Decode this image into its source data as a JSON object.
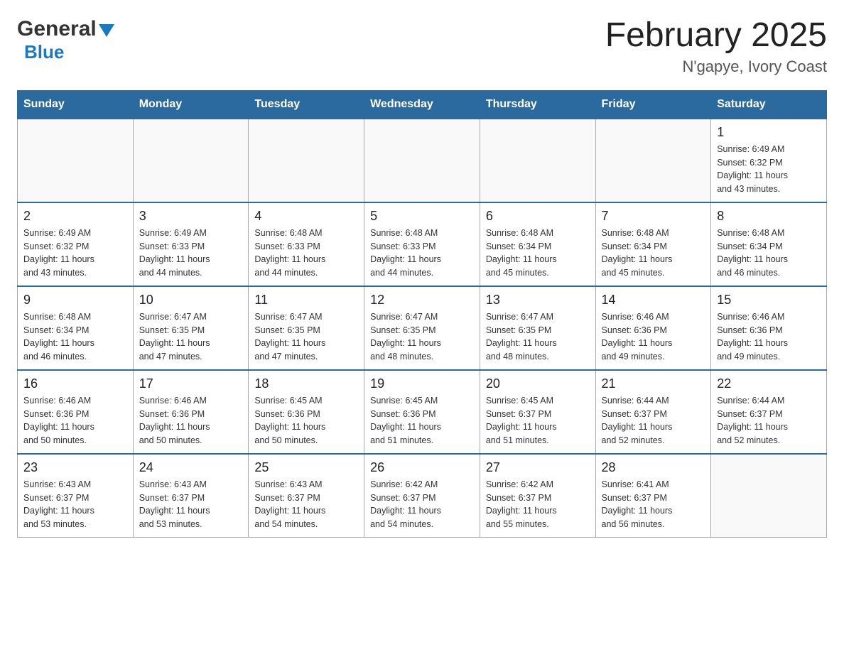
{
  "header": {
    "logo_general": "General",
    "logo_blue": "Blue",
    "main_title": "February 2025",
    "subtitle": "N'gapye, Ivory Coast"
  },
  "days_of_week": [
    "Sunday",
    "Monday",
    "Tuesday",
    "Wednesday",
    "Thursday",
    "Friday",
    "Saturday"
  ],
  "weeks": [
    [
      {
        "day": "",
        "info": ""
      },
      {
        "day": "",
        "info": ""
      },
      {
        "day": "",
        "info": ""
      },
      {
        "day": "",
        "info": ""
      },
      {
        "day": "",
        "info": ""
      },
      {
        "day": "",
        "info": ""
      },
      {
        "day": "1",
        "info": "Sunrise: 6:49 AM\nSunset: 6:32 PM\nDaylight: 11 hours\nand 43 minutes."
      }
    ],
    [
      {
        "day": "2",
        "info": "Sunrise: 6:49 AM\nSunset: 6:32 PM\nDaylight: 11 hours\nand 43 minutes."
      },
      {
        "day": "3",
        "info": "Sunrise: 6:49 AM\nSunset: 6:33 PM\nDaylight: 11 hours\nand 44 minutes."
      },
      {
        "day": "4",
        "info": "Sunrise: 6:48 AM\nSunset: 6:33 PM\nDaylight: 11 hours\nand 44 minutes."
      },
      {
        "day": "5",
        "info": "Sunrise: 6:48 AM\nSunset: 6:33 PM\nDaylight: 11 hours\nand 44 minutes."
      },
      {
        "day": "6",
        "info": "Sunrise: 6:48 AM\nSunset: 6:34 PM\nDaylight: 11 hours\nand 45 minutes."
      },
      {
        "day": "7",
        "info": "Sunrise: 6:48 AM\nSunset: 6:34 PM\nDaylight: 11 hours\nand 45 minutes."
      },
      {
        "day": "8",
        "info": "Sunrise: 6:48 AM\nSunset: 6:34 PM\nDaylight: 11 hours\nand 46 minutes."
      }
    ],
    [
      {
        "day": "9",
        "info": "Sunrise: 6:48 AM\nSunset: 6:34 PM\nDaylight: 11 hours\nand 46 minutes."
      },
      {
        "day": "10",
        "info": "Sunrise: 6:47 AM\nSunset: 6:35 PM\nDaylight: 11 hours\nand 47 minutes."
      },
      {
        "day": "11",
        "info": "Sunrise: 6:47 AM\nSunset: 6:35 PM\nDaylight: 11 hours\nand 47 minutes."
      },
      {
        "day": "12",
        "info": "Sunrise: 6:47 AM\nSunset: 6:35 PM\nDaylight: 11 hours\nand 48 minutes."
      },
      {
        "day": "13",
        "info": "Sunrise: 6:47 AM\nSunset: 6:35 PM\nDaylight: 11 hours\nand 48 minutes."
      },
      {
        "day": "14",
        "info": "Sunrise: 6:46 AM\nSunset: 6:36 PM\nDaylight: 11 hours\nand 49 minutes."
      },
      {
        "day": "15",
        "info": "Sunrise: 6:46 AM\nSunset: 6:36 PM\nDaylight: 11 hours\nand 49 minutes."
      }
    ],
    [
      {
        "day": "16",
        "info": "Sunrise: 6:46 AM\nSunset: 6:36 PM\nDaylight: 11 hours\nand 50 minutes."
      },
      {
        "day": "17",
        "info": "Sunrise: 6:46 AM\nSunset: 6:36 PM\nDaylight: 11 hours\nand 50 minutes."
      },
      {
        "day": "18",
        "info": "Sunrise: 6:45 AM\nSunset: 6:36 PM\nDaylight: 11 hours\nand 50 minutes."
      },
      {
        "day": "19",
        "info": "Sunrise: 6:45 AM\nSunset: 6:36 PM\nDaylight: 11 hours\nand 51 minutes."
      },
      {
        "day": "20",
        "info": "Sunrise: 6:45 AM\nSunset: 6:37 PM\nDaylight: 11 hours\nand 51 minutes."
      },
      {
        "day": "21",
        "info": "Sunrise: 6:44 AM\nSunset: 6:37 PM\nDaylight: 11 hours\nand 52 minutes."
      },
      {
        "day": "22",
        "info": "Sunrise: 6:44 AM\nSunset: 6:37 PM\nDaylight: 11 hours\nand 52 minutes."
      }
    ],
    [
      {
        "day": "23",
        "info": "Sunrise: 6:43 AM\nSunset: 6:37 PM\nDaylight: 11 hours\nand 53 minutes."
      },
      {
        "day": "24",
        "info": "Sunrise: 6:43 AM\nSunset: 6:37 PM\nDaylight: 11 hours\nand 53 minutes."
      },
      {
        "day": "25",
        "info": "Sunrise: 6:43 AM\nSunset: 6:37 PM\nDaylight: 11 hours\nand 54 minutes."
      },
      {
        "day": "26",
        "info": "Sunrise: 6:42 AM\nSunset: 6:37 PM\nDaylight: 11 hours\nand 54 minutes."
      },
      {
        "day": "27",
        "info": "Sunrise: 6:42 AM\nSunset: 6:37 PM\nDaylight: 11 hours\nand 55 minutes."
      },
      {
        "day": "28",
        "info": "Sunrise: 6:41 AM\nSunset: 6:37 PM\nDaylight: 11 hours\nand 56 minutes."
      },
      {
        "day": "",
        "info": ""
      }
    ]
  ]
}
